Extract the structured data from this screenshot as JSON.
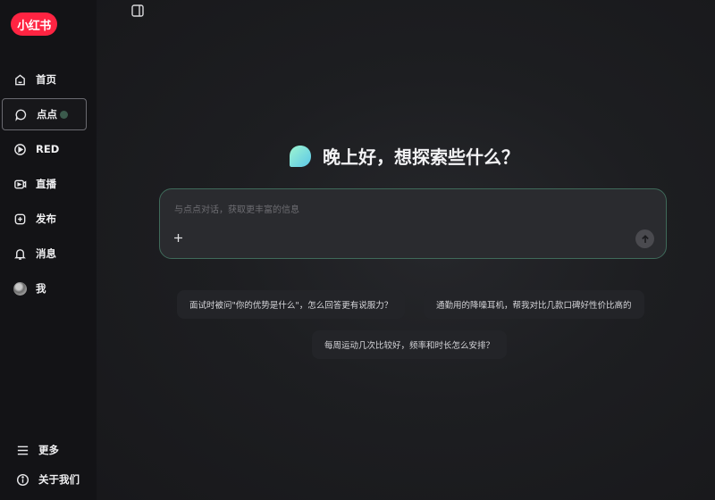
{
  "brand": {
    "logo_text": "小红书",
    "accent": "#ff2442"
  },
  "sidebar": {
    "items": [
      {
        "label": "首页",
        "icon": "home-icon"
      },
      {
        "label": "点点",
        "icon": "chat-bubble-icon",
        "active": true
      },
      {
        "label": "RED",
        "icon": "play-circle-icon"
      },
      {
        "label": "直播",
        "icon": "live-icon"
      },
      {
        "label": "发布",
        "icon": "plus-square-icon"
      },
      {
        "label": "消息",
        "icon": "bell-icon"
      },
      {
        "label": "我",
        "icon": "avatar"
      }
    ],
    "bottom": [
      {
        "label": "更多",
        "icon": "menu-icon"
      },
      {
        "label": "关于我们",
        "icon": "info-icon"
      }
    ]
  },
  "main": {
    "greeting": "晚上好，想探索些什么？",
    "input": {
      "placeholder": "与点点对话，获取更丰富的信息",
      "value": ""
    },
    "suggestions": [
      "面试时被问\"你的优势是什么\"，怎么回答更有说服力？",
      "通勤用的降噪耳机，帮我对比几款口碑好性价比高的",
      "每周运动几次比较好，频率和时长怎么安排？"
    ]
  }
}
